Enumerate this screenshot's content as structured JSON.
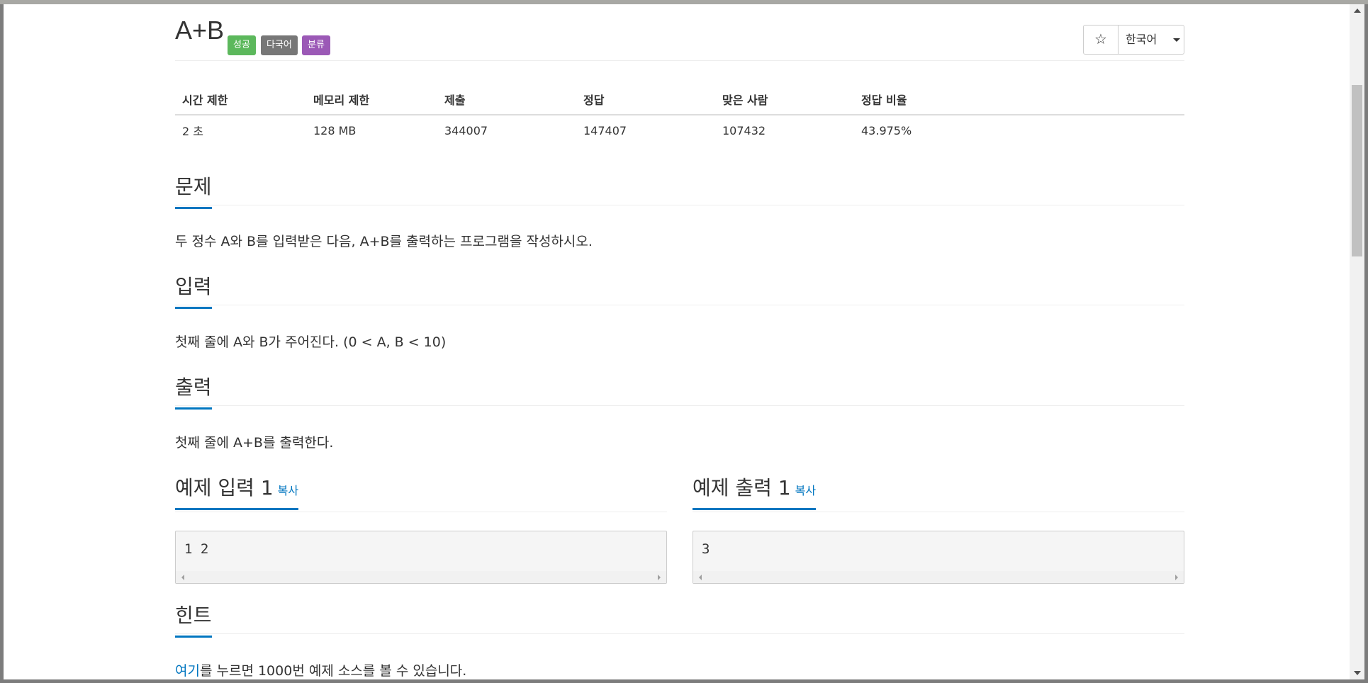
{
  "problem": {
    "title": "A+B",
    "labels": [
      "성공",
      "다국어",
      "분류"
    ]
  },
  "header": {
    "star_icon": "☆",
    "language": "한국어"
  },
  "info_table": {
    "headers": [
      "시간 제한",
      "메모리 제한",
      "제출",
      "정답",
      "맞은 사람",
      "정답 비율"
    ],
    "row": [
      "2 초",
      "128 MB",
      "344007",
      "147407",
      "107432",
      "43.975%"
    ]
  },
  "sections": {
    "problem": {
      "title": "문제",
      "text": "두 정수 A와 B를 입력받은 다음, A+B를 출력하는 프로그램을 작성하시오."
    },
    "input": {
      "title": "입력",
      "text": "첫째 줄에 A와 B가 주어진다. (0 < A, B < 10)"
    },
    "output": {
      "title": "출력",
      "text": "첫째 줄에 A+B를 출력한다."
    },
    "sample_input": {
      "title": "예제 입력 1",
      "copy": "복사",
      "content": "1 2"
    },
    "sample_output": {
      "title": "예제 출력 1",
      "copy": "복사",
      "content": "3"
    },
    "hint": {
      "title": "힌트",
      "link_text": "여기",
      "text": "를 누르면 1000번 예제 소스를 볼 수 있습니다."
    }
  },
  "colors": {
    "label_success": "#5cb85c",
    "label_multilang": "#777777",
    "label_category": "#9b59b6",
    "accent": "#0076c0"
  }
}
